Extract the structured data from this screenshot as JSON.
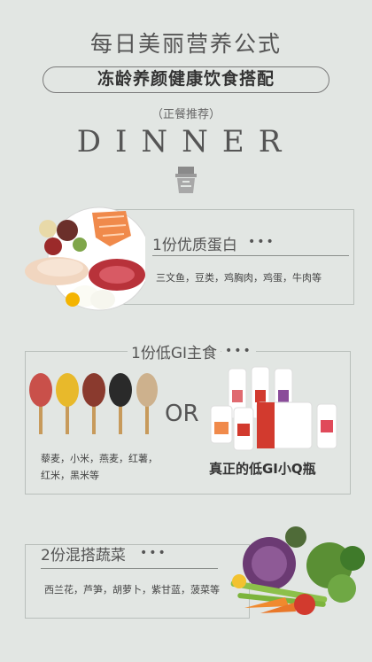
{
  "header": {
    "title": "每日美丽营养公式",
    "pill": "冻龄养颜健康饮食搭配",
    "subtitle": "（正餐推荐）",
    "dinner": "DINNER"
  },
  "section1": {
    "title": "1份优质蛋白",
    "dots": "•••",
    "items": "三文鱼，豆类，鸡胸肉，鸡蛋，牛肉等"
  },
  "section2": {
    "title": "1份低GI主食",
    "dots": "•••",
    "items_line1": "藜麦，小米，燕麦，红薯，",
    "items_line2": "红米，黑米等",
    "or": "OR",
    "caption": "真正的低GI小Q瓶"
  },
  "section3": {
    "title": "2份混搭蔬菜",
    "dots": "•••",
    "items": "西兰花，芦笋，胡萝卜，紫甘蓝，菠菜等"
  },
  "colors": {
    "background": "#e2e6e3",
    "text": "#4a4a4a",
    "accent_red": "#d23a2e"
  }
}
